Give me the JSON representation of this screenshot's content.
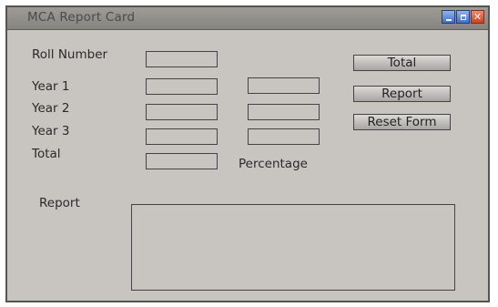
{
  "window": {
    "title": "MCA Report Card"
  },
  "form": {
    "roll_number_label": "Roll Number",
    "year1_label": "Year 1",
    "year2_label": "Year 2",
    "year3_label": "Year 3",
    "total_label": "Total",
    "percentage_label": "Percentage",
    "report_label": "Report",
    "roll_number_value": "",
    "year1_value": "",
    "year1_pct_value": "",
    "year2_value": "",
    "year2_pct_value": "",
    "year3_value": "",
    "year3_pct_value": "",
    "total_value": "",
    "report_value": ""
  },
  "buttons": {
    "total_label": "Total",
    "report_label": "Report",
    "reset_label": "Reset Form"
  },
  "icons": {
    "minimize": "minimize-icon",
    "maximize": "maximize-icon",
    "close": "close-icon"
  },
  "colors": {
    "window_bg": "#c8c5c1",
    "titlebar": "#8e8c88",
    "close_button": "#cf3f1e",
    "window_button": "#3b6fd6"
  }
}
